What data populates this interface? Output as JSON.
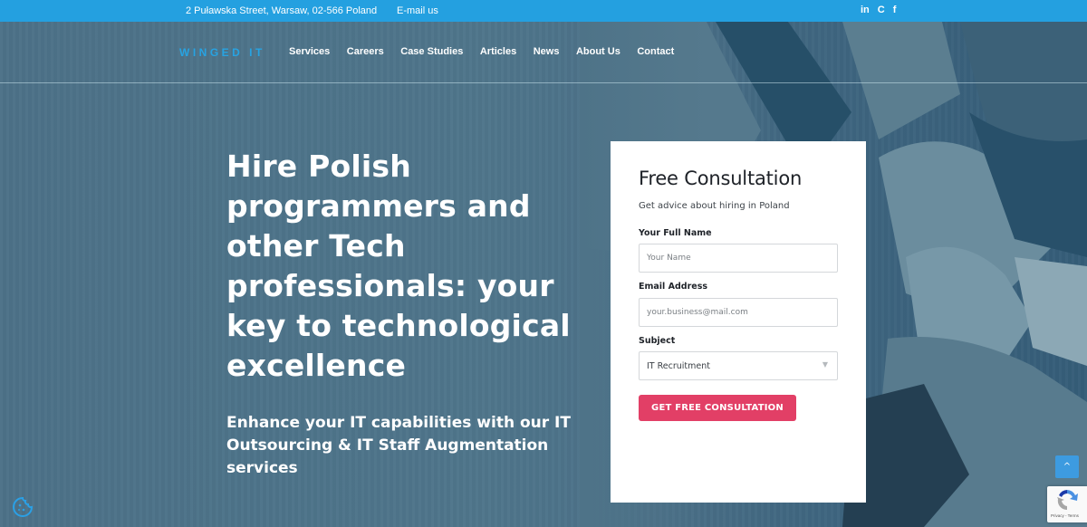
{
  "topbar": {
    "address": "2 Puławska Street, Warsaw, 02-566 Poland",
    "email_link": "E-mail us",
    "social": [
      {
        "icon": "linkedin-icon",
        "glyph": "in"
      },
      {
        "icon": "clutch-icon",
        "glyph": "C"
      },
      {
        "icon": "facebook-icon",
        "glyph": "f"
      }
    ],
    "bg_color": "#24a0e0"
  },
  "nav": {
    "logo": "WINGED IT",
    "items": [
      "Services",
      "Careers",
      "Case Studies",
      "Articles",
      "News",
      "About Us",
      "Contact"
    ]
  },
  "hero": {
    "headline": "Hire Polish programmers and other Tech professionals: your key to technological excellence",
    "subheadline": "Enhance your IT capabilities with our IT Outsourcing & IT Staff Augmentation services"
  },
  "form": {
    "title": "Free Consultation",
    "subtitle": "Get advice about hiring in Poland",
    "name_label": "Your Full Name",
    "name_placeholder": "Your Name",
    "email_label": "Email Address",
    "email_placeholder": "your.business@mail.com",
    "subject_label": "Subject",
    "subject_value": "IT Recruitment",
    "submit_label": "GET FREE CONSULTATION",
    "accent_color": "#e23f66"
  },
  "widgets": {
    "scroll_top_glyph": "^",
    "recaptcha_terms": "Privacy - Terms"
  }
}
